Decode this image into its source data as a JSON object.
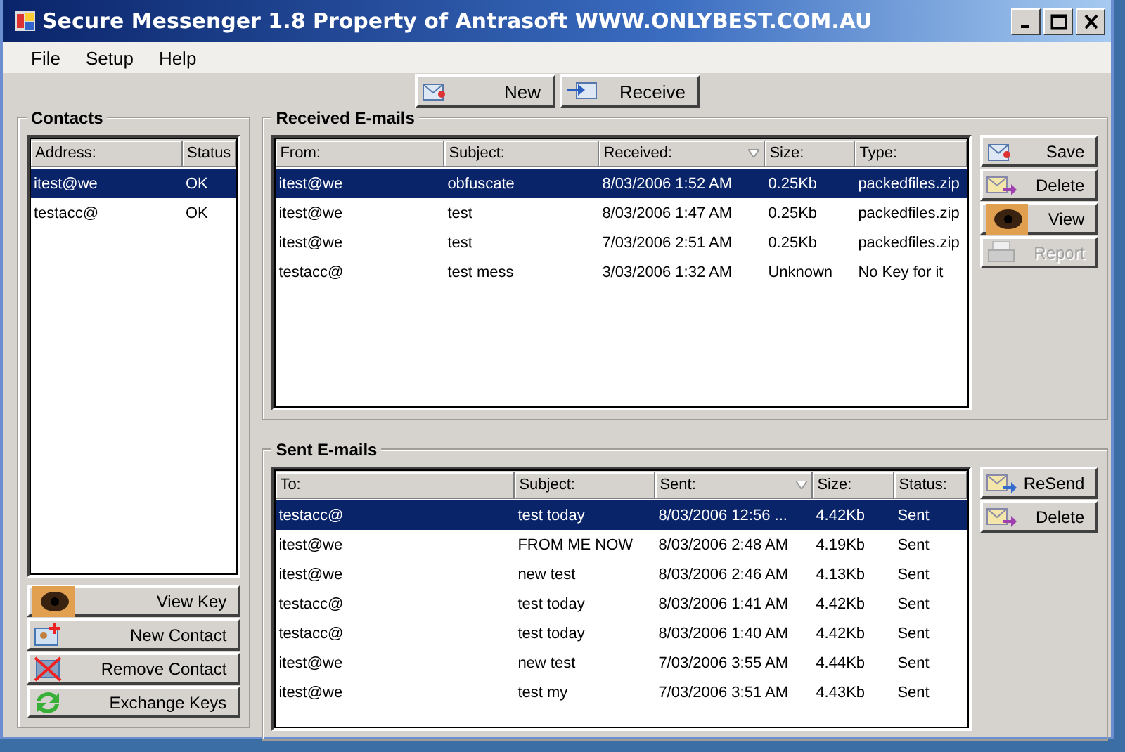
{
  "window": {
    "title": "Secure Messenger 1.8  Property of Antrasoft WWW.ONLYBEST.COM.AU"
  },
  "menu": [
    "File",
    "Setup",
    "Help"
  ],
  "toolbar": [
    {
      "label": "New"
    },
    {
      "label": "Receive"
    }
  ],
  "contacts": {
    "title": "Contacts",
    "columns": [
      {
        "label": "Address:"
      },
      {
        "label": "Status"
      }
    ],
    "rows": [
      {
        "cells": [
          "itest@we",
          "OK"
        ],
        "selected": true
      },
      {
        "cells": [
          "testacc@",
          "OK"
        ],
        "selected": false
      }
    ],
    "buttons": [
      {
        "label": "View Key"
      },
      {
        "label": "New Contact"
      },
      {
        "label": "Remove Contact"
      },
      {
        "label": "Exchange Keys"
      }
    ]
  },
  "received": {
    "title": "Received E-mails",
    "columns": [
      {
        "label": "From:",
        "sorted": false
      },
      {
        "label": "Subject:",
        "sorted": false
      },
      {
        "label": "Received:",
        "sorted": true
      },
      {
        "label": "Size:",
        "sorted": false
      },
      {
        "label": "Type:",
        "sorted": false
      }
    ],
    "rows": [
      {
        "cells": [
          "itest@we",
          "obfuscate",
          "8/03/2006 1:52 AM",
          "0.25Kb",
          "packedfiles.zip"
        ],
        "selected": true
      },
      {
        "cells": [
          "itest@we",
          "test",
          "8/03/2006 1:47 AM",
          "0.25Kb",
          "packedfiles.zip"
        ],
        "selected": false
      },
      {
        "cells": [
          "itest@we",
          "test",
          "7/03/2006 2:51 AM",
          "0.25Kb",
          "packedfiles.zip"
        ],
        "selected": false
      },
      {
        "cells": [
          "testacc@",
          "test mess",
          "3/03/2006 1:32 AM",
          "Unknown",
          "No Key for it"
        ],
        "selected": false
      }
    ],
    "buttons": [
      {
        "label": "Save",
        "disabled": false
      },
      {
        "label": "Delete",
        "disabled": false
      },
      {
        "label": "View",
        "disabled": false
      },
      {
        "label": "Report",
        "disabled": true
      }
    ]
  },
  "sent": {
    "title": "Sent E-mails",
    "columns": [
      {
        "label": "To:",
        "sorted": false
      },
      {
        "label": "Subject:",
        "sorted": false
      },
      {
        "label": "Sent:",
        "sorted": true
      },
      {
        "label": "Size:",
        "sorted": false
      },
      {
        "label": "Status:",
        "sorted": false
      }
    ],
    "rows": [
      {
        "cells": [
          "testacc@",
          "test today",
          "8/03/2006 12:56 ...",
          "4.42Kb",
          "Sent"
        ],
        "selected": true
      },
      {
        "cells": [
          "itest@we",
          "FROM ME NOW",
          "8/03/2006 2:48 AM",
          "4.19Kb",
          "Sent"
        ],
        "selected": false
      },
      {
        "cells": [
          "itest@we",
          "new test",
          "8/03/2006 2:46 AM",
          "4.13Kb",
          "Sent"
        ],
        "selected": false
      },
      {
        "cells": [
          "testacc@",
          "test today",
          "8/03/2006 1:41 AM",
          "4.42Kb",
          "Sent"
        ],
        "selected": false
      },
      {
        "cells": [
          "testacc@",
          "test today",
          "8/03/2006 1:40 AM",
          "4.42Kb",
          "Sent"
        ],
        "selected": false
      },
      {
        "cells": [
          "itest@we",
          "new test",
          "7/03/2006 3:55 AM",
          "4.44Kb",
          "Sent"
        ],
        "selected": false
      },
      {
        "cells": [
          "itest@we",
          "test my",
          "7/03/2006 3:51 AM",
          "4.43Kb",
          "Sent"
        ],
        "selected": false
      }
    ],
    "buttons": [
      {
        "label": "ReSend",
        "disabled": false
      },
      {
        "label": "Delete",
        "disabled": false
      }
    ]
  }
}
